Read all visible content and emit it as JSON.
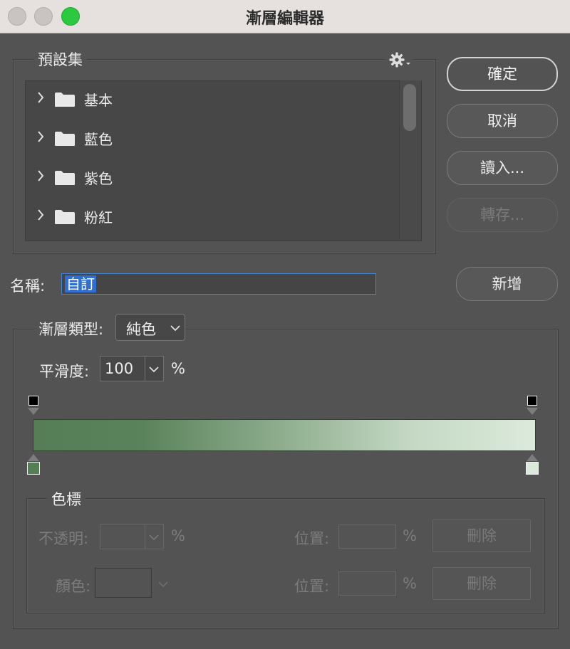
{
  "window": {
    "title": "漸層編輯器"
  },
  "presets": {
    "legend": "預設集",
    "items": [
      {
        "label": "基本"
      },
      {
        "label": "藍色"
      },
      {
        "label": "紫色"
      },
      {
        "label": "粉紅"
      }
    ]
  },
  "buttons": {
    "ok": "確定",
    "cancel": "取消",
    "load": "讀入...",
    "export": "轉存...",
    "new": "新增"
  },
  "name": {
    "label": "名稱:",
    "value": "自訂"
  },
  "gradient": {
    "type_label": "漸層類型:",
    "type_value": "純色",
    "smooth_label": "平滑度:",
    "smooth_value": "100",
    "smooth_unit": "%",
    "colors": {
      "start": "#567e56",
      "mid": "#8fae8f",
      "end": "#dceadb"
    }
  },
  "stops": {
    "legend": "色標",
    "opacity_label": "不透明:",
    "opacity_unit": "%",
    "color_label": "顏色:",
    "location_label": "位置:",
    "location_unit": "%",
    "delete_label": "刪除"
  }
}
